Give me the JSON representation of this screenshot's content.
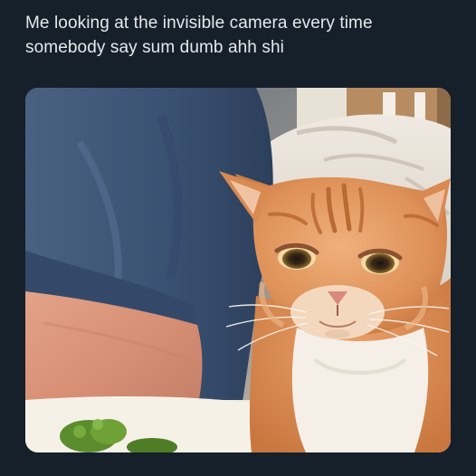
{
  "post": {
    "caption_lines": [
      "Me looking at the invisible camera every time",
      "somebody say sum dumb ahh shi"
    ]
  },
  "photo": {
    "subject": "orange tabby cat staring at camera beside a person in a blue t-shirt"
  },
  "colors": {
    "background": "#15202b",
    "text": "#e7e9ea",
    "cat_orange": "#d9874a",
    "shirt_blue": "#3f5677"
  }
}
